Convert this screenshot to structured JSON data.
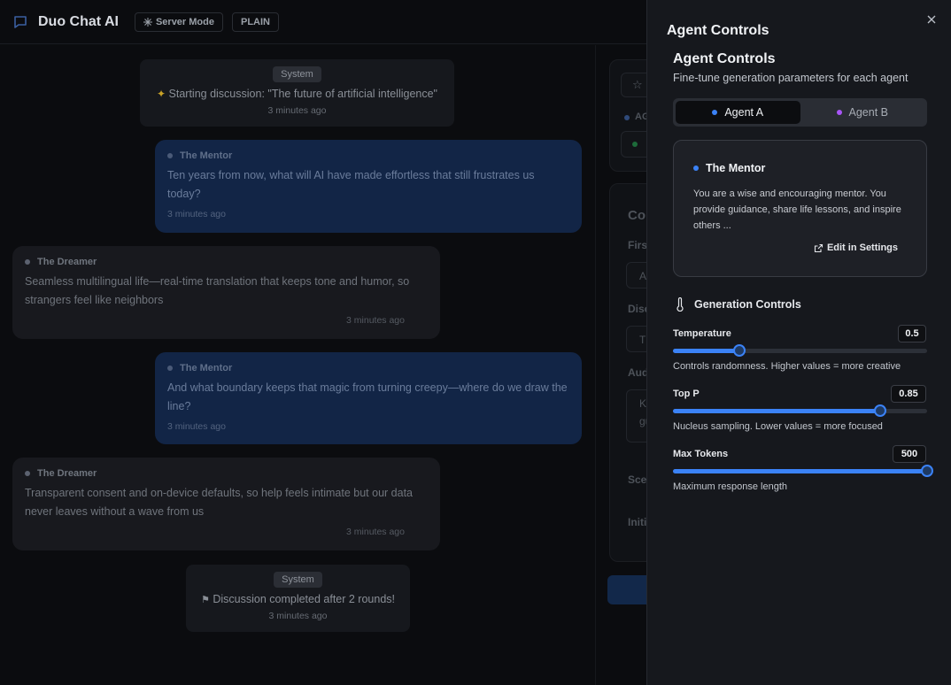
{
  "header": {
    "app_title": "Duo Chat AI",
    "mode_label": "Server Mode",
    "format_label": "PLAIN"
  },
  "chat": {
    "system_start": {
      "badge": "System",
      "text": "Starting discussion: \"The future of artificial intelligence\"",
      "time": "3 minutes ago"
    },
    "messages": [
      {
        "author": "The Mentor",
        "text": "Ten years from now, what will AI have made effortless that still frustrates us today?",
        "time": "3 minutes ago"
      },
      {
        "author": "The Dreamer",
        "text": "Seamless multilingual life—real-time translation that keeps tone and humor, so strangers feel like neighbors",
        "time": "3 minutes ago"
      },
      {
        "author": "The Mentor",
        "text": "And what boundary keeps that magic from turning creepy—where do we draw the line?",
        "time": "3 minutes ago"
      },
      {
        "author": "The Dreamer",
        "text": "Transparent consent and on-device defaults, so help feels intimate but our data never leaves without a wave from us",
        "time": "3 minutes ago"
      }
    ],
    "system_end": {
      "badge": "System",
      "text": "Discussion completed after 2 rounds!",
      "time": "3 minutes ago"
    }
  },
  "middle_panel": {
    "fragments": [
      "AG",
      "Co",
      "First",
      "A",
      "Disc",
      "Th",
      "Aud",
      "Ke",
      "gu",
      "Sce",
      "Initi"
    ]
  },
  "drawer": {
    "title": "Agent Controls",
    "section_title": "Agent Controls",
    "section_subtitle": "Fine-tune generation parameters for each agent",
    "tabs": [
      {
        "label": "Agent A",
        "color": "#3b82f6",
        "active": true
      },
      {
        "label": "Agent B",
        "color": "#a855f7",
        "active": false
      }
    ],
    "agent_card": {
      "name": "The Mentor",
      "prompt": "You are a wise and encouraging mentor. You provide guidance, share life lessons, and inspire others ...",
      "edit_label": "Edit in Settings"
    },
    "generation": {
      "title": "Generation Controls",
      "controls": [
        {
          "label": "Temperature",
          "value": "0.5",
          "level": 0.26,
          "help": "Controls randomness. Higher values = more creative"
        },
        {
          "label": "Top P",
          "value": "0.85",
          "level": 0.817,
          "help": "Nucleus sampling. Lower values = more focused"
        },
        {
          "label": "Max Tokens",
          "value": "500",
          "level": 1.0,
          "help": "Maximum response length"
        }
      ]
    }
  },
  "colors": {
    "accent": "#3b82f6",
    "agent_b": "#a855f7",
    "mentor_bubble": "#122546",
    "dreamer_bubble": "#18191e"
  }
}
